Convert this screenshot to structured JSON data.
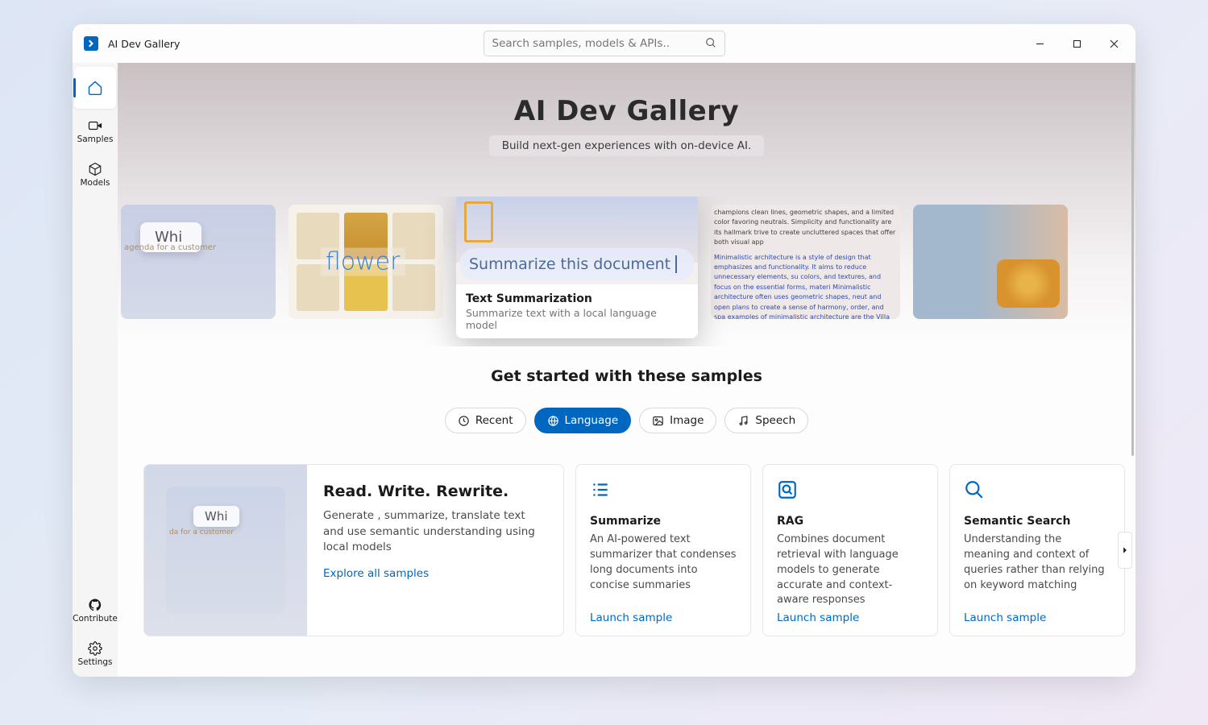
{
  "titlebar": {
    "app_title": "AI Dev Gallery",
    "search_placeholder": "Search samples, models & APIs.."
  },
  "nav": {
    "items": [
      {
        "label": ""
      },
      {
        "label": "Samples"
      },
      {
        "label": "Models"
      }
    ],
    "bottom": [
      {
        "label": "Contribute"
      },
      {
        "label": "Settings"
      }
    ]
  },
  "hero": {
    "title": "AI Dev Gallery",
    "subtitle": "Build next-gen experiences with on-device AI."
  },
  "carousel": {
    "card1_text": "Whi",
    "card1_sub": "agenda for a customer",
    "card2_tag": "flower",
    "featured_input": "Summarize this document",
    "featured_title": "Text Summarization",
    "featured_desc": "Summarize text with a local language model",
    "card4_p1": "champions clean lines, geometric shapes, and a limited color favoring neutrals. Simplicity and functionality are its hallmark trive to create uncluttered spaces that offer both visual app",
    "card4_p2": "Minimalistic architecture is a style of design that emphasizes and functionality. It aims to reduce unnecessary elements, su colors, and textures, and focus on the essential forms, materi Minimalistic architecture often uses geometric shapes, neut and open plans to create a sense of harmony, order, and spa examples of minimalistic architecture are the Villa Savoye by arnsworth House by Mies van der Rohe, and the Glass Hous"
  },
  "samples": {
    "section_title": "Get started with these samples",
    "chips": [
      {
        "label": "Recent"
      },
      {
        "label": "Language"
      },
      {
        "label": "Image"
      },
      {
        "label": "Speech"
      }
    ],
    "big_card": {
      "thumb_text": "Whi",
      "thumb_sub": "da for a customer",
      "title": "Read. Write. Rewrite.",
      "desc": "Generate , summarize, translate text and use semantic understanding using local models",
      "link": "Explore all samples"
    },
    "cards": [
      {
        "title": "Summarize",
        "desc": "An AI-powered text summarizer that condenses long documents into concise summaries",
        "link": "Launch sample"
      },
      {
        "title": "RAG",
        "desc": "Combines document retrieval with language models to generate accurate and context-aware responses",
        "link": "Launch sample"
      },
      {
        "title": "Semantic Search",
        "desc": "Understanding the meaning and context of queries rather than relying on keyword matching",
        "link": "Launch sample"
      }
    ]
  }
}
